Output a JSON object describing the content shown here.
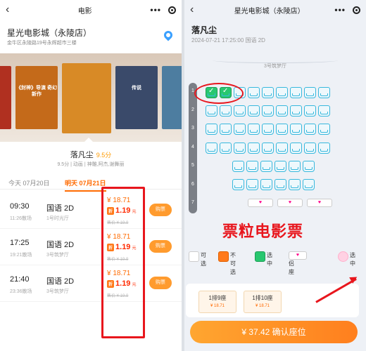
{
  "left": {
    "topbar": {
      "title": "电影"
    },
    "cinema": {
      "name": "星光电影城（永陵店）",
      "address": "金牛区永陵路19号永辉超市三楼"
    },
    "posters": [
      {
        "caption": "",
        "color": "#b03020"
      },
      {
        "caption": "《封神》导演 奇幻新作",
        "color": "#c46a1a"
      },
      {
        "caption": "",
        "color": "#d88a26"
      },
      {
        "caption": "传说",
        "color": "#3a4a6a"
      },
      {
        "caption": "",
        "color": "#4d7da0"
      }
    ],
    "movie": {
      "title": "落凡尘",
      "score": "9.5分",
      "meta": "9.5分 | 动画 | 神雕,阿杰,谢舞丽"
    },
    "dates": [
      {
        "label": "今天 07月20日"
      },
      {
        "label": "明天 07月21日"
      }
    ],
    "showtimes": [
      {
        "time": "09:30",
        "end": "11:26散场",
        "lang": "国语 2D",
        "hall": "1号时光厅",
        "price": "¥ 18.71",
        "discount": "1.19",
        "disc_tag": "折",
        "disc_unit": "元",
        "orig": "售价 ¥ 19.9",
        "buy": "购票"
      },
      {
        "time": "17:25",
        "end": "19:21散场",
        "lang": "国语 2D",
        "hall": "3号筑梦厅",
        "price": "¥ 18.71",
        "discount": "1.19",
        "disc_tag": "折",
        "disc_unit": "元",
        "orig": "售价 ¥ 19.9",
        "buy": "购票"
      },
      {
        "time": "21:40",
        "end": "23:36散场",
        "lang": "国语 2D",
        "hall": "3号筑梦厅",
        "price": "¥ 18.71",
        "discount": "1.19",
        "disc_tag": "折",
        "disc_unit": "元",
        "orig": "售价 ¥ 19.9",
        "buy": "购票"
      }
    ]
  },
  "right": {
    "topbar": {
      "title": "星光电影城（永陵店）"
    },
    "movie_title": "落凡尘",
    "show_time": "2024-07-21 17:25:00 国语 2D",
    "hall": "3号筑梦厅",
    "rows": [
      "1",
      "2",
      "3",
      "4",
      "5",
      "6",
      "7"
    ],
    "watermark": "票粒电影票",
    "legend": [
      {
        "label": "可选",
        "kind": "free"
      },
      {
        "label": "不可选",
        "kind": "sold"
      },
      {
        "label": "选中",
        "kind": "mine"
      },
      {
        "label": "情侣座",
        "kind": "couple"
      },
      {
        "label": "选中",
        "kind": "pink"
      }
    ],
    "chosen": [
      {
        "seat": "1排9座",
        "price": "¥ 18.71"
      },
      {
        "seat": "1排10座",
        "price": "¥ 18.71"
      }
    ],
    "confirm": "¥ 37.42 确认座位"
  }
}
